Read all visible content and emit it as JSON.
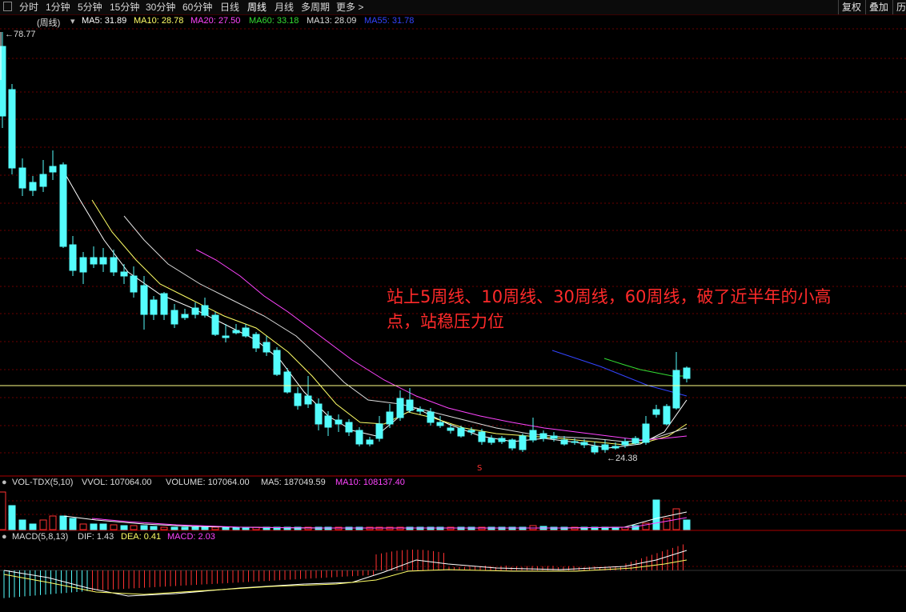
{
  "toolbar": {
    "periods": [
      "分时",
      "1分钟",
      "5分钟",
      "15分钟",
      "30分钟",
      "60分钟",
      "日线",
      "周线",
      "月线",
      "多周期",
      "更多 >"
    ],
    "active_period": "周线",
    "right_buttons": [
      "复权",
      "叠加",
      "历"
    ]
  },
  "main_panel": {
    "period_label": "(周线)",
    "ma": [
      {
        "label": "MA5: 31.89",
        "color": "#ffffff"
      },
      {
        "label": "MA10: 28.78",
        "color": "#ffff66"
      },
      {
        "label": "MA20: 27.50",
        "color": "#ff44ff"
      },
      {
        "label": "MA60: 33.18",
        "color": "#33dd33"
      },
      {
        "label": "MA13: 28.09",
        "color": "#dddddd"
      },
      {
        "label": "MA55: 31.78",
        "color": "#3344ff"
      }
    ],
    "high_label": "78.77",
    "low_label": "24.38",
    "annotation_line1": "站上5周线、10周线、30周线，60周线，破了近半年的小高",
    "annotation_line2": "点，站稳压力位"
  },
  "volume_panel": {
    "name": "VOL-TDX(5,10)",
    "vvol": "VVOL: 107064.00",
    "volume": "VOLUME: 107064.00",
    "ma5": "MA5: 187049.59",
    "ma10": "MA10: 108137.40"
  },
  "macd_panel": {
    "name": "MACD(5,8,13)",
    "dif": "DIF: 1.43",
    "dea": "DEA: 0.41",
    "macd": "MACD: 2.03"
  },
  "colors": {
    "up": "#ff3232",
    "down": "#54fcfc",
    "ma5": "#ffffff",
    "ma10": "#ffff66",
    "ma20": "#ff44ff",
    "ma60": "#33dd33",
    "ma55": "#3344ff",
    "grid": "#6b0000"
  }
}
